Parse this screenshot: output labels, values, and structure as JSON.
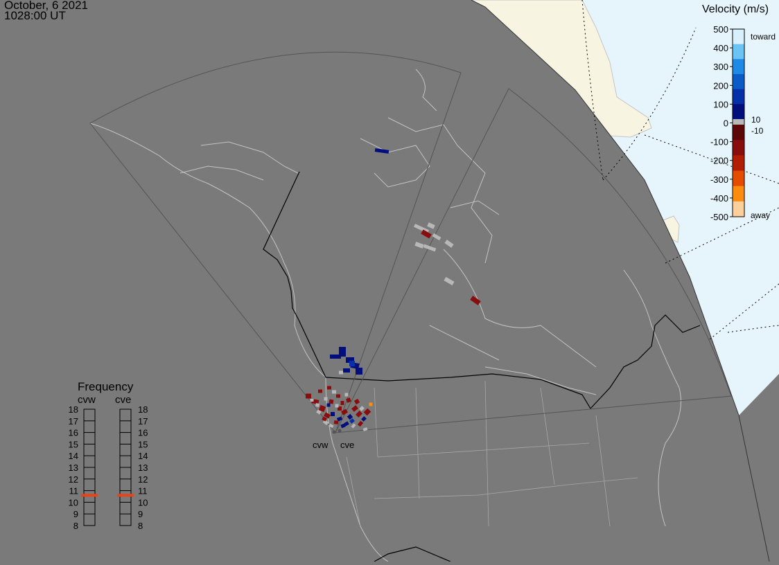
{
  "header": {
    "date": "October, 6 2021",
    "time": "1028:00 UT"
  },
  "velocity_scale": {
    "title": "Velocity (m/s)",
    "ticks": [
      "500",
      "400",
      "300",
      "200",
      "100",
      "0",
      "-100",
      "-200",
      "-300",
      "-400",
      "-500"
    ],
    "toward_label": "toward",
    "away_label": "away",
    "pos_threshold": "10",
    "neg_threshold": "-10",
    "colors": [
      "#d8f0fc",
      "#6cc4f4",
      "#1e8ae6",
      "#0b5bc6",
      "#0630a8",
      "#020e7c",
      "#b8b8b8",
      "#5c0606",
      "#8a0d0d",
      "#b21e04",
      "#e44c00",
      "#fc8c10",
      "#fcd09c"
    ]
  },
  "frequency_panel": {
    "title": "Frequency",
    "radars": [
      "cvw",
      "cve"
    ],
    "scale": [
      "18",
      "17",
      "16",
      "15",
      "14",
      "13",
      "12",
      "11",
      "10",
      "9",
      "8"
    ],
    "values_mhz": [
      10.6,
      10.6
    ],
    "marker_color": "#e8441a"
  },
  "map": {
    "radar_sites": [
      "cvw",
      "cve"
    ],
    "colors": {
      "background": "#7a7a7a",
      "land": "#f8f4e2",
      "ocean": "#e6f4fc",
      "country_border": "#000000",
      "coastline": "#c4c4c4",
      "fov": "#545454"
    }
  }
}
